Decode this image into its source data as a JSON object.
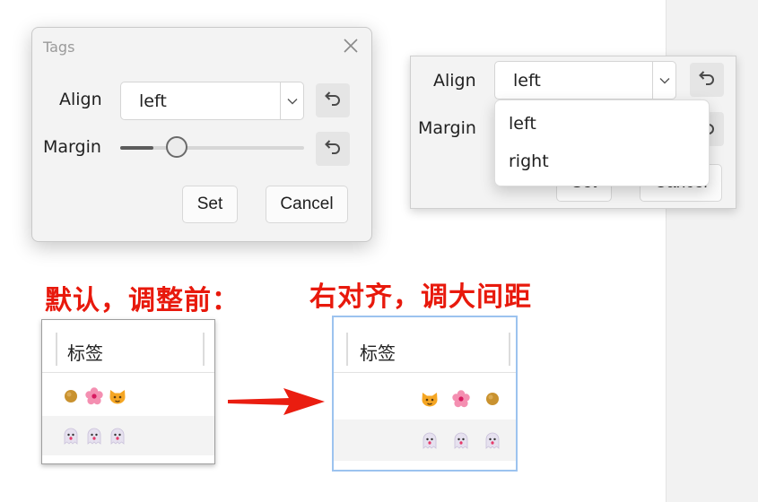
{
  "dialog": {
    "title": "Tags",
    "align_label": "Align",
    "align_value": "left",
    "margin_label": "Margin",
    "margin_fraction": 0.18,
    "set_label": "Set",
    "cancel_label": "Cancel"
  },
  "dropdown_dialog": {
    "align_label": "Align",
    "align_value": "left",
    "margin_label": "Margin",
    "set_label": "Set",
    "cancel_label": "Cancel",
    "options": [
      "left",
      "right"
    ]
  },
  "annotations": {
    "before": "默认，调整前：",
    "after": "右对齐，调大间距"
  },
  "table_before": {
    "header": "标签",
    "rows": [
      [
        "dot",
        "blossom",
        "cat"
      ],
      [
        "ghost",
        "ghost",
        "ghost"
      ]
    ]
  },
  "table_after": {
    "header": "标签",
    "rows": [
      [
        "cat",
        "blossom",
        "dot"
      ],
      [
        "ghost",
        "ghost",
        "ghost"
      ]
    ]
  },
  "colors": {
    "annotation_red": "#e8190c",
    "selection_border": "#9cc3ef"
  }
}
